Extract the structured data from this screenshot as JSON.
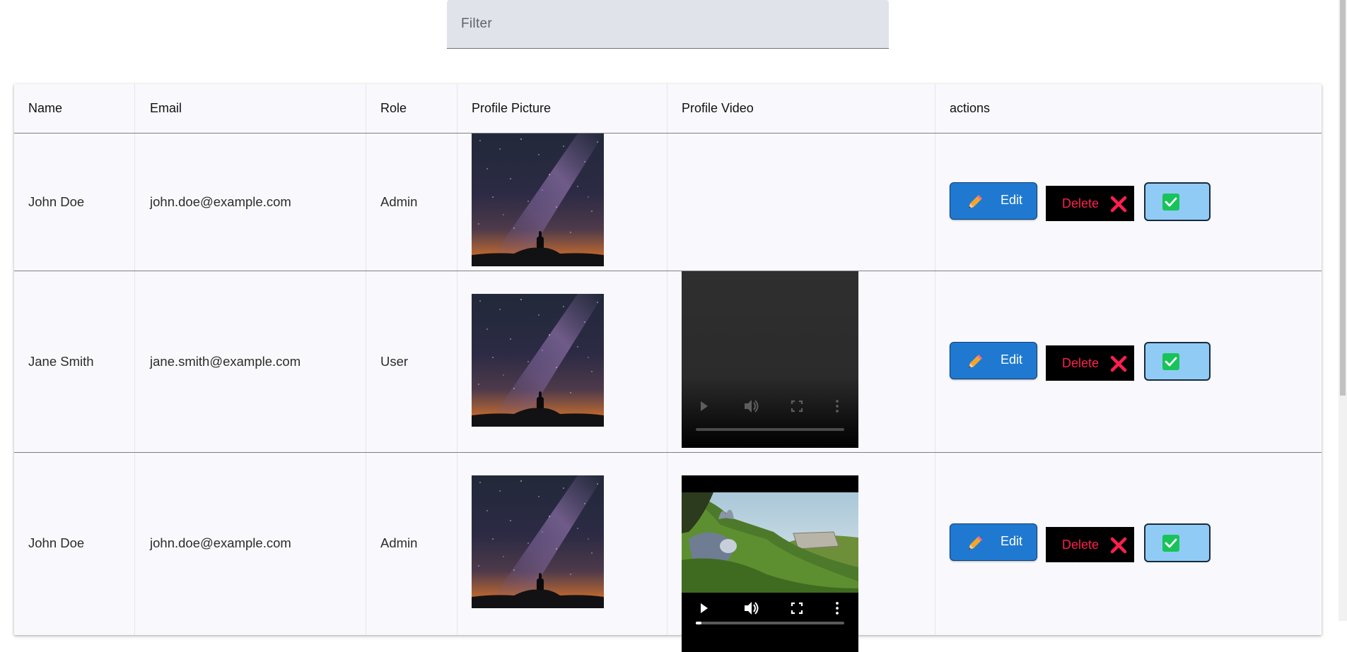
{
  "filter": {
    "placeholder": "Filter",
    "value": ""
  },
  "table": {
    "headers": {
      "name": "Name",
      "email": "Email",
      "role": "Role",
      "picture": "Profile Picture",
      "video": "Profile Video",
      "actions": "actions"
    },
    "rows": [
      {
        "name": "John Doe",
        "email": "john.doe@example.com",
        "role": "Admin",
        "video": "none"
      },
      {
        "name": "Jane Smith",
        "email": "jane.smith@example.com",
        "role": "User",
        "video": "loading"
      },
      {
        "name": "John Doe",
        "email": "john.doe@example.com",
        "role": "Admin",
        "video": "bunny"
      }
    ]
  },
  "actions": {
    "edit_label": "Edit",
    "delete_label": "Delete"
  },
  "icons": {
    "edit": "pencil-icon",
    "delete": "cross-mark-icon",
    "confirm": "check-mark-icon"
  },
  "colors": {
    "edit_button": "#1f79d1",
    "delete_button": "#000000",
    "delete_text": "#ff1f4e",
    "confirm_button": "#90cbf6",
    "confirm_check": "#18c35a"
  }
}
